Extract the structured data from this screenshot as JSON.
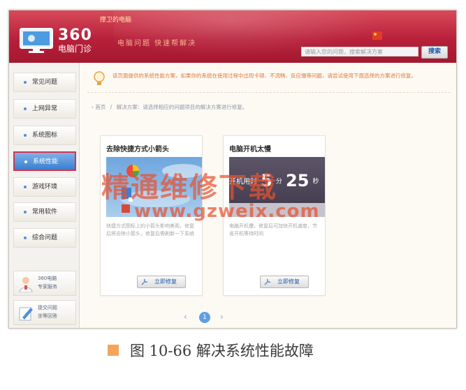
{
  "header": {
    "guard_text": "撑卫的电脑",
    "logo_number": "360",
    "logo_subtitle": "电脑门诊",
    "slogan": "电脑问题  快速帮解决",
    "search": {
      "placeholder": "请输入您的问题，搜索解决方案",
      "button_label": "搜索"
    }
  },
  "sidebar": {
    "items": [
      {
        "label": "常见问题"
      },
      {
        "label": "上网异常"
      },
      {
        "label": "系统图标"
      },
      {
        "label": "系统性能"
      },
      {
        "label": "游戏环境"
      },
      {
        "label": "常用软件"
      },
      {
        "label": "综合问题"
      }
    ],
    "active_index": 3,
    "expert": {
      "line1": "360电脑",
      "line2": "专家服务"
    },
    "feedback": {
      "line1": "提交问题",
      "line2": "坐等回答"
    }
  },
  "main": {
    "tip": "该页面提供的系统性能方案，如果你的系统在使用过程中出现卡顿、不流畅、反应慢等问题，请尝试使用下面选择的方案进行修复。",
    "breadcrumb": [
      "首页",
      "解决方案：请选择相应的问题项目的解决方案进行修复。"
    ],
    "cards": [
      {
        "title": "去除快捷方式小箭头",
        "desc": "快捷方式图标上的小箭头影响美观，修复后将去除小箭头，修复后需刷新一下系统",
        "button": "立即修复"
      },
      {
        "title": "电脑开机太慢",
        "image_prefix": "开机用时",
        "image_minutes": "5",
        "image_min_unit": "分",
        "image_seconds": "25",
        "image_sec_unit": "秒",
        "desc": "电脑开机慢，修复后可加快开机速度，节省开机等待时间",
        "button": "立即修复"
      }
    ],
    "pager": {
      "prev": "‹",
      "current": "1",
      "next": "›"
    }
  },
  "watermark": {
    "text": "精通维修下载",
    "url": "www.gzweix.com"
  },
  "caption": "图 10-66   解决系统性能故障",
  "colors": {
    "header_red": "#b8203a",
    "active_blue": "#3a7fcf",
    "active_border": "#d9324f",
    "tip_orange": "#e0783c",
    "watermark": "#e85230",
    "caption_square": "#f5a45c"
  }
}
